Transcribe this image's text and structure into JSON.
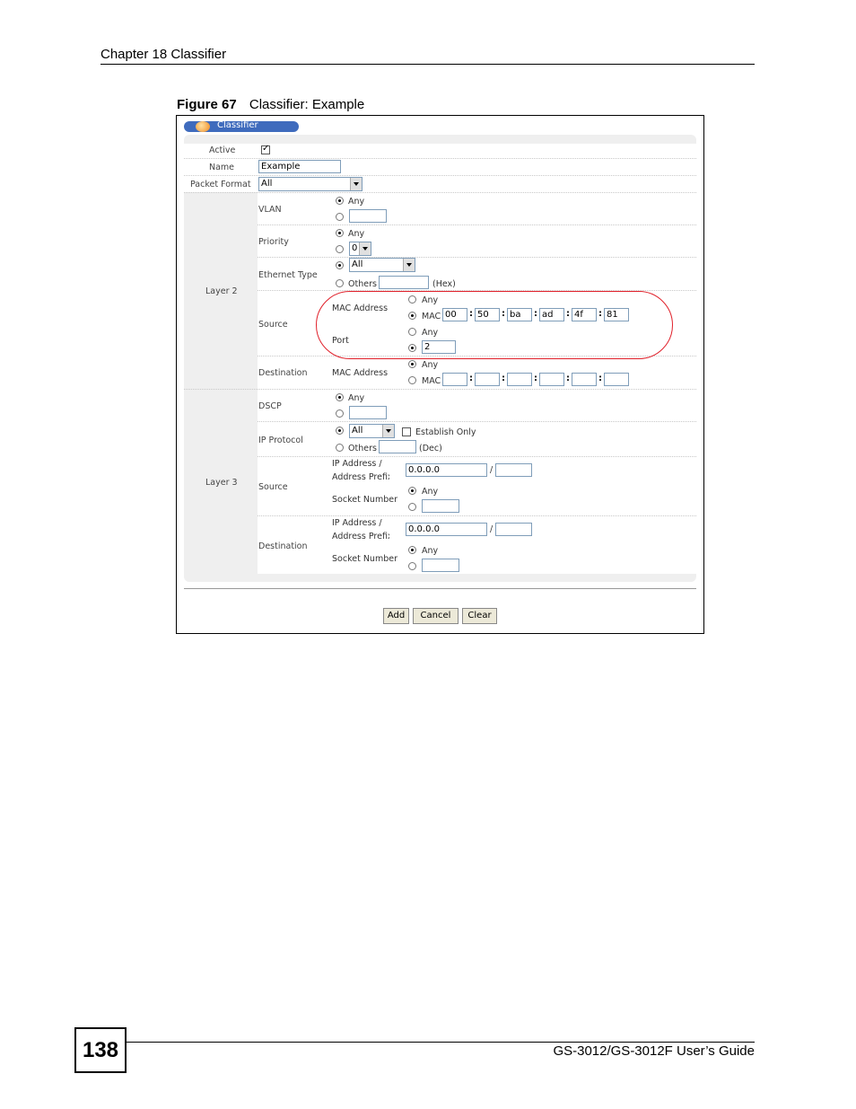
{
  "header": {
    "chapter": "Chapter 18 Classifier"
  },
  "figure": {
    "number": "Figure 67",
    "caption": "Classifier: Example"
  },
  "form": {
    "tab_title": "Classifier",
    "active_label": "Active",
    "active_checked": true,
    "name_label": "Name",
    "name_value": "Example",
    "packet_format_label": "Packet Format",
    "packet_format_value": "All",
    "layer2_label": "Layer 2",
    "layer3_label": "Layer 3",
    "vlan_label": "VLAN",
    "priority_label": "Priority",
    "priority_value": "0",
    "ethernet_type_label": "Ethernet Type",
    "ethernet_type_value": "All",
    "others_label": "Others",
    "hex_label": "(Hex)",
    "dec_label": "(Dec)",
    "any_label": "Any",
    "mac_label": "MAC",
    "source_label": "Source",
    "destination_label": "Destination",
    "mac_address_label": "MAC Address",
    "port_label": "Port",
    "source_mac": [
      "00",
      "50",
      "ba",
      "ad",
      "4f",
      "81"
    ],
    "source_port": "2",
    "dscp_label": "DSCP",
    "ip_protocol_label": "IP Protocol",
    "ip_protocol_value": "All",
    "establish_only_label": "Establish Only",
    "ip_address_label": "IP Address /",
    "address_prefix_label": "Address Prefix",
    "socket_number_label": "Socket Number",
    "src_ip": "0.0.0.0",
    "dst_ip": "0.0.0.0",
    "slash": "/",
    "colon": ":",
    "add_label": "Add",
    "cancel_label": "Cancel",
    "clear_label": "Clear"
  },
  "footer": {
    "page_number": "138",
    "guide": "GS-3012/GS-3012F User’s Guide"
  }
}
